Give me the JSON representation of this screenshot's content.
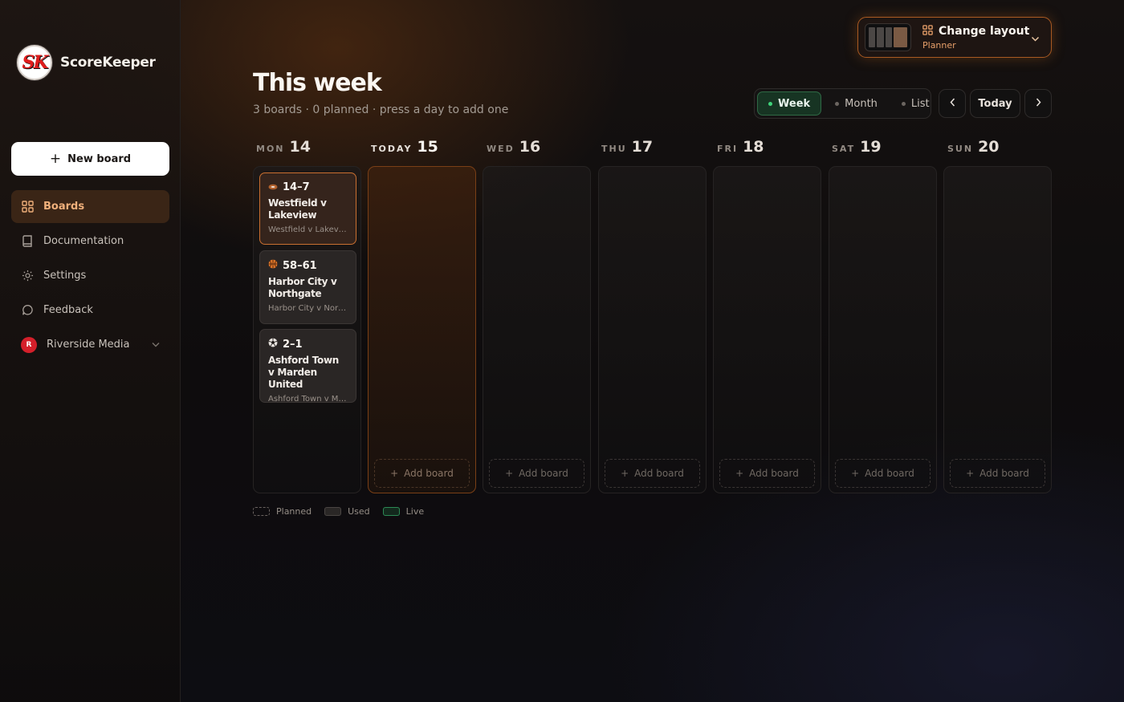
{
  "app": {
    "name": "ScoreKeeper",
    "logo_text": "SK"
  },
  "sidebar": {
    "new_board_label": "New board",
    "items": [
      {
        "label": "Boards",
        "icon": "grid-icon",
        "active": true
      },
      {
        "label": "Documentation",
        "icon": "book-icon",
        "active": false
      },
      {
        "label": "Settings",
        "icon": "sun-gear-icon",
        "active": false
      },
      {
        "label": "Feedback",
        "icon": "chat-bubble-icon",
        "active": false
      }
    ],
    "org": {
      "initial": "R",
      "name": "Riverside Media"
    }
  },
  "header": {
    "title": "This week",
    "subtitle": "3 boards · 0 planned · press a day to add one"
  },
  "layout_switcher": {
    "title": "Change layout",
    "current": "Planner"
  },
  "view_toggle": {
    "options": [
      "Week",
      "Month",
      "List"
    ],
    "selected": "Week"
  },
  "date_nav": {
    "today_label": "Today",
    "prev": "‹",
    "next": "›"
  },
  "week": {
    "days": [
      {
        "name": "MON",
        "num": "14",
        "today": false
      },
      {
        "name": "TODAY",
        "num": "15",
        "today": true
      },
      {
        "name": "WED",
        "num": "16",
        "today": false
      },
      {
        "name": "THU",
        "num": "17",
        "today": false
      },
      {
        "name": "FRI",
        "num": "18",
        "today": false
      },
      {
        "name": "SAT",
        "num": "19",
        "today": false
      },
      {
        "name": "SUN",
        "num": "20",
        "today": false
      }
    ],
    "add_board_label": "Add board",
    "boards": [
      {
        "day": 0,
        "sport_icon": "football-icon",
        "score": "14–7",
        "title": "Westfield v Lakeview",
        "subtitle": "Westfield v Lakeview",
        "selected": true
      },
      {
        "day": 0,
        "sport_icon": "basketball-icon",
        "score": "58–61",
        "title": "Harbor City v Northgate",
        "subtitle": "Harbor City v North…",
        "selected": false
      },
      {
        "day": 0,
        "sport_icon": "soccer-ball-icon",
        "score": "2–1",
        "title": "Ashford Town v Marden United",
        "subtitle": "Ashford Town v Ma…",
        "selected": false
      }
    ]
  },
  "legend": [
    "Planned",
    "Used",
    "Live"
  ],
  "colors": {
    "accent": "#c96f30",
    "active_nav_text": "#f0b07b",
    "live_green": "#3fd37a",
    "org_red": "#d41f2a"
  }
}
